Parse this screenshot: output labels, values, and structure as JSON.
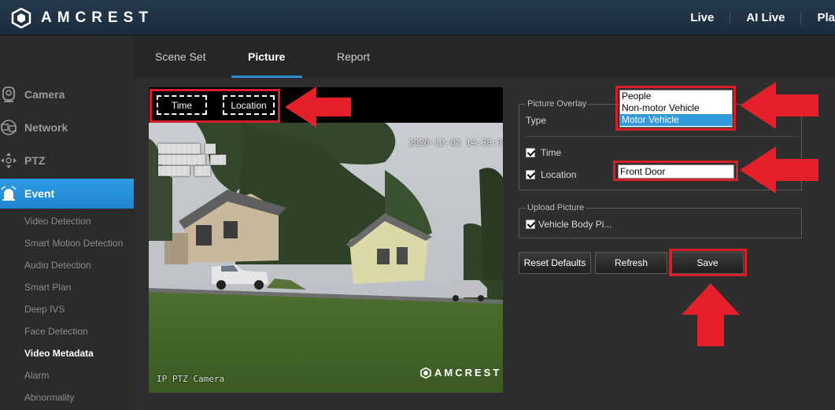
{
  "brand": {
    "name": "AMCREST"
  },
  "top_nav": [
    {
      "label": "Live"
    },
    {
      "label": "AI Live"
    },
    {
      "label": "Pla"
    }
  ],
  "sidebar": {
    "main": [
      {
        "label": "Camera",
        "icon": "camera-icon"
      },
      {
        "label": "Network",
        "icon": "network-icon"
      },
      {
        "label": "PTZ",
        "icon": "ptz-icon"
      },
      {
        "label": "Event",
        "icon": "alarm-bell-icon",
        "active": true
      }
    ],
    "sub": [
      {
        "label": "Video Detection"
      },
      {
        "label": "Smart Motion Detection"
      },
      {
        "label": "Audio Detection"
      },
      {
        "label": "Smart Plan"
      },
      {
        "label": "Deep IVS"
      },
      {
        "label": "Face Detection"
      },
      {
        "label": "Video Metadata",
        "active": true
      },
      {
        "label": "Alarm"
      },
      {
        "label": "Abnormality"
      }
    ]
  },
  "tabs": [
    {
      "label": "Scene Set"
    },
    {
      "label": "Picture",
      "active": true
    },
    {
      "label": "Report"
    }
  ],
  "video": {
    "time_chip": "Time",
    "location_chip": "Location",
    "osd_top_right": "2020-12-02 14:38:31",
    "osd_bottom_left": "IP PTZ Camera",
    "watermark": "AMCREST"
  },
  "picture_overlay": {
    "legend": "Picture Overlay",
    "type_label": "Type",
    "type_options": [
      "People",
      "Non-motor Vehicle",
      "Motor Vehicle"
    ],
    "type_selected": "Motor Vehicle",
    "time_label": "Time",
    "time_checked": true,
    "location_label": "Location",
    "location_checked": true,
    "location_value": "Front Door"
  },
  "upload_picture": {
    "legend": "Upload Picture",
    "vehicle_body_label": "Vehicle Body Pi...",
    "vehicle_body_checked": true
  },
  "buttons": {
    "reset_defaults": "Reset Defaults",
    "refresh": "Refresh",
    "save": "Save"
  },
  "colors": {
    "accent": "#2a8fd6",
    "annotation_red": "#d61f26",
    "selected_option": "#3399dd"
  }
}
